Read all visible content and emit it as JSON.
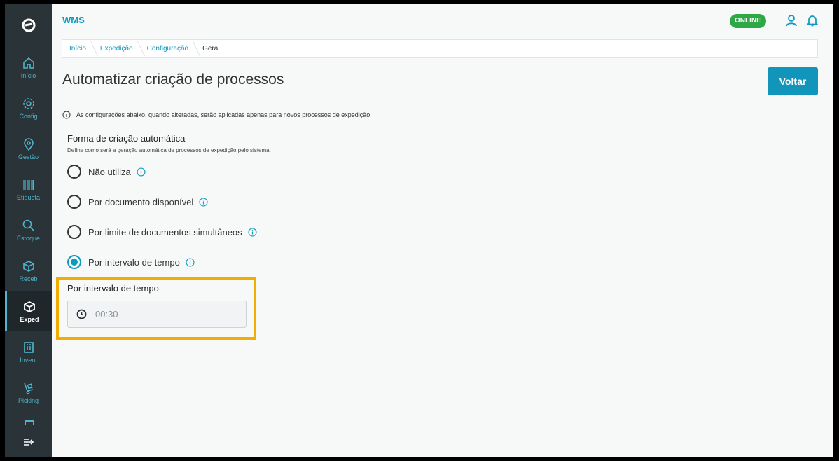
{
  "app": {
    "title": "WMS",
    "status": "ONLINE"
  },
  "sidebar": {
    "items": [
      {
        "label": "Início",
        "icon": "home-icon"
      },
      {
        "label": "Config",
        "icon": "gear-icon"
      },
      {
        "label": "Gestão",
        "icon": "location-pin-icon"
      },
      {
        "label": "Etiqueta",
        "icon": "barcode-icon"
      },
      {
        "label": "Estoque",
        "icon": "search-icon"
      },
      {
        "label": "Receb",
        "icon": "box-icon"
      },
      {
        "label": "Exped",
        "icon": "box-icon",
        "active": true
      },
      {
        "label": "Invent",
        "icon": "building-icon"
      },
      {
        "label": "Picking",
        "icon": "hand-truck-icon"
      }
    ]
  },
  "breadcrumb": [
    "Início",
    "Expedição",
    "Configuração",
    "Geral"
  ],
  "page": {
    "title": "Automatizar criação de processos",
    "back_label": "Voltar",
    "info": "As configurações abaixo, quando alteradas, serão aplicadas apenas para novos processos de expedição"
  },
  "section": {
    "title": "Forma de criação automática",
    "description": "Define como será a geração automática de processos de expedição pelo sistema.",
    "options": [
      {
        "label": "Não utiliza",
        "selected": false
      },
      {
        "label": "Por documento disponível",
        "selected": false
      },
      {
        "label": "Por limite de documentos simultâneos",
        "selected": false
      },
      {
        "label": "Por intervalo de tempo",
        "selected": true
      }
    ]
  },
  "interval": {
    "label": "Por intervalo de tempo",
    "value": "00:30"
  },
  "colors": {
    "accent": "#0c9abe",
    "sidebar": "#2a3338",
    "online": "#2da844",
    "highlight": "#f2ae00"
  }
}
